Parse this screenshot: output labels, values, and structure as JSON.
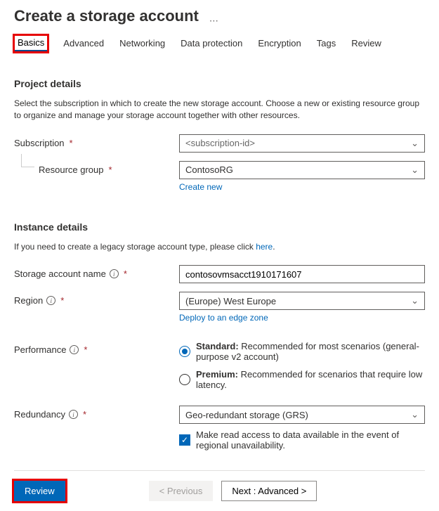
{
  "header": {
    "title": "Create a storage account"
  },
  "tabs": [
    "Basics",
    "Advanced",
    "Networking",
    "Data protection",
    "Encryption",
    "Tags",
    "Review"
  ],
  "project": {
    "heading": "Project details",
    "desc": "Select the subscription in which to create the new storage account. Choose a new or existing resource group to organize and manage your storage account together with other resources.",
    "subscription_label": "Subscription",
    "subscription_value": "<subscription-id>",
    "rg_label": "Resource group",
    "rg_value": "ContosoRG",
    "create_new": "Create new"
  },
  "instance": {
    "heading": "Instance details",
    "desc_prefix": "If you need to create a legacy storage account type, please click ",
    "desc_link": "here",
    "desc_suffix": ".",
    "name_label": "Storage account name",
    "name_value": "contosovmsacct1910171607",
    "region_label": "Region",
    "region_value": "(Europe) West Europe",
    "edge_link": "Deploy to an edge zone",
    "perf_label": "Performance",
    "perf_standard_bold": "Standard:",
    "perf_standard_desc": " Recommended for most scenarios (general-purpose v2 account)",
    "perf_premium_bold": "Premium:",
    "perf_premium_desc": " Recommended for scenarios that require low latency.",
    "redundancy_label": "Redundancy",
    "redundancy_value": "Geo-redundant storage (GRS)",
    "ra_label": "Make read access to data available in the event of regional unavailability."
  },
  "footer": {
    "review": "Review",
    "previous": "< Previous",
    "next": "Next : Advanced >"
  }
}
